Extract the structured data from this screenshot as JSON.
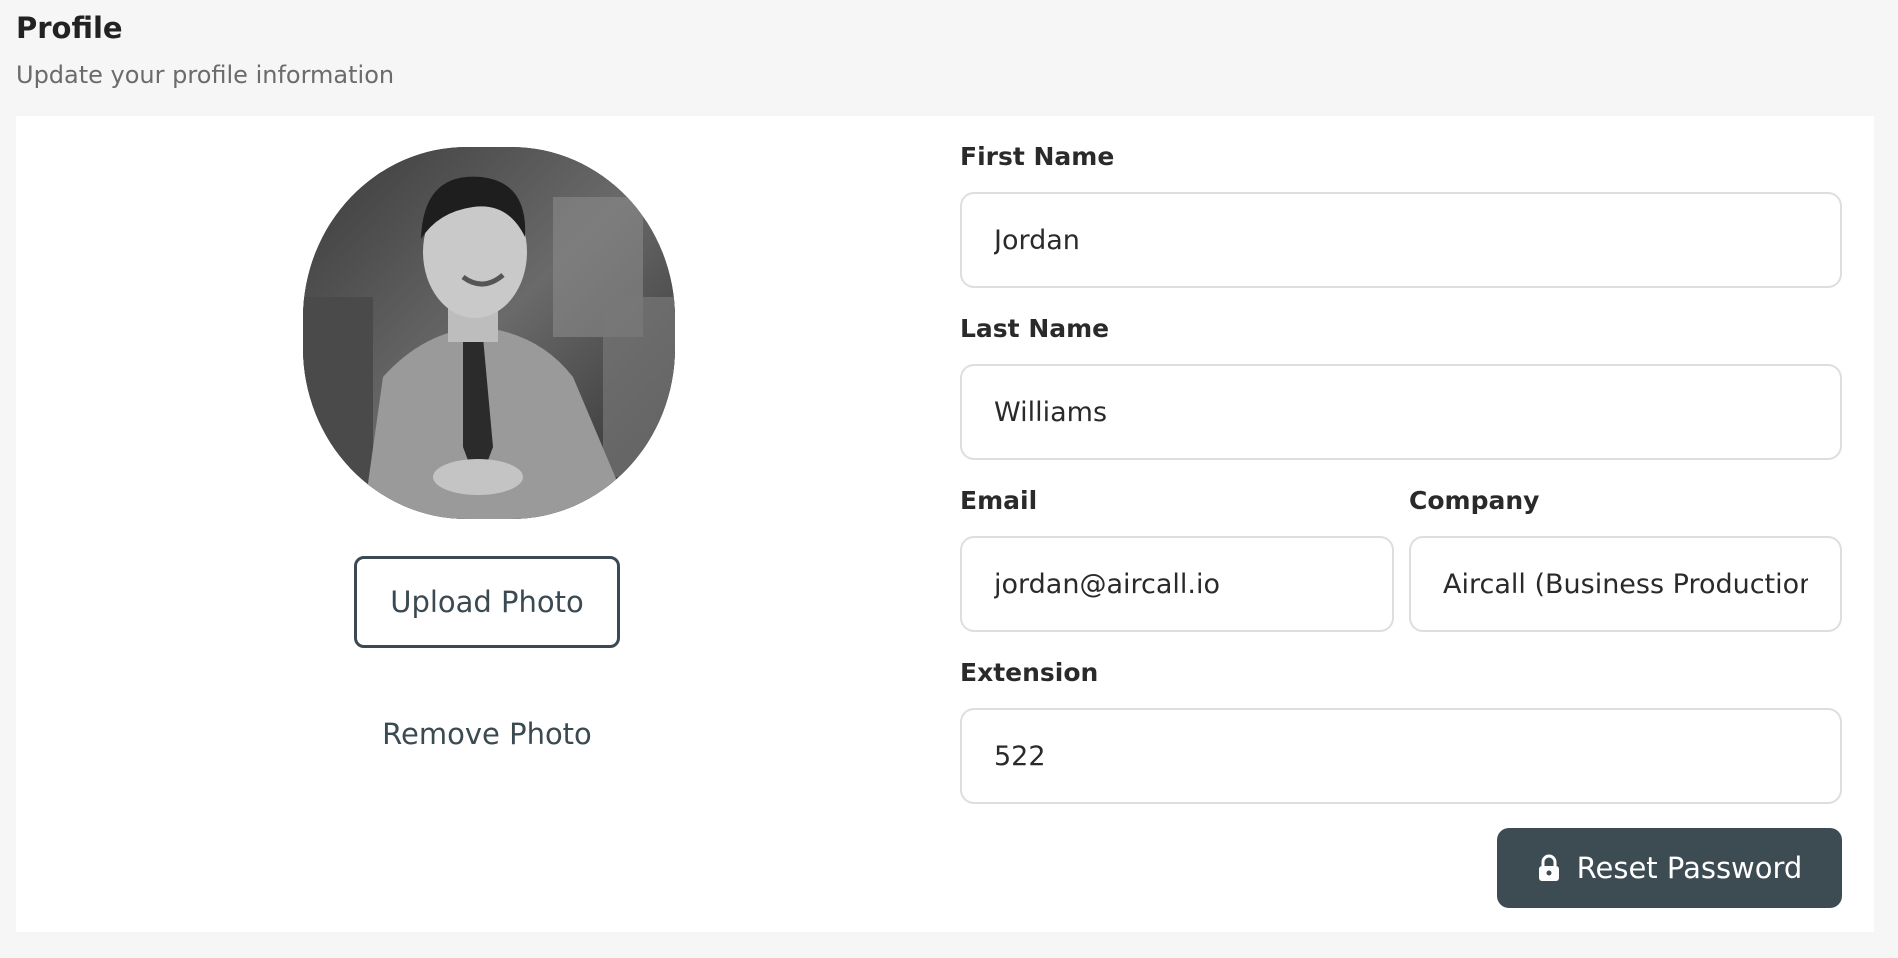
{
  "header": {
    "title": "Profile",
    "subtitle": "Update your profile information"
  },
  "photo": {
    "upload_label": "Upload Photo",
    "remove_label": "Remove Photo"
  },
  "form": {
    "first_name": {
      "label": "First Name",
      "value": "Jordan"
    },
    "last_name": {
      "label": "Last Name",
      "value": "Williams"
    },
    "email": {
      "label": "Email",
      "value": "jordan@aircall.io"
    },
    "company": {
      "label": "Company",
      "value": "Aircall (Business Production)"
    },
    "extension": {
      "label": "Extension",
      "value": "522"
    }
  },
  "actions": {
    "reset_password_label": "Reset Password",
    "reset_icon": "lock-icon"
  },
  "colors": {
    "page_bg": "#f6f6f6",
    "card_bg": "#ffffff",
    "primary_dark": "#3d4b53",
    "field_border": "#dedede"
  }
}
